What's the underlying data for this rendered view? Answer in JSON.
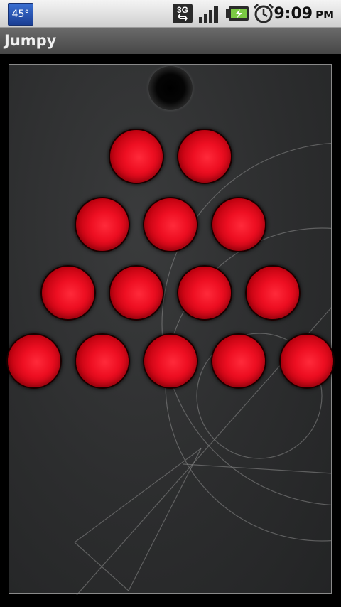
{
  "status_bar": {
    "weather_temp": "45°",
    "network_type": "3G",
    "clock_time": "9:09",
    "clock_ampm": "PM",
    "icons": [
      "weather-icon",
      "3g-data-icon",
      "signal-icon",
      "battery-charging-icon",
      "alarm-clock-icon"
    ]
  },
  "app_bar": {
    "title": "Jumpy"
  },
  "game": {
    "peg_rows": [
      {
        "row": 1,
        "state": [
          "empty"
        ]
      },
      {
        "row": 2,
        "state": [
          "ball",
          "ball"
        ]
      },
      {
        "row": 3,
        "state": [
          "ball",
          "ball",
          "ball"
        ]
      },
      {
        "row": 4,
        "state": [
          "ball",
          "ball",
          "ball",
          "ball"
        ]
      },
      {
        "row": 5,
        "state": [
          "ball",
          "ball",
          "ball",
          "ball",
          "ball"
        ]
      }
    ],
    "ball_color": "#ee0f22",
    "board_color": "#2c2d2e"
  }
}
